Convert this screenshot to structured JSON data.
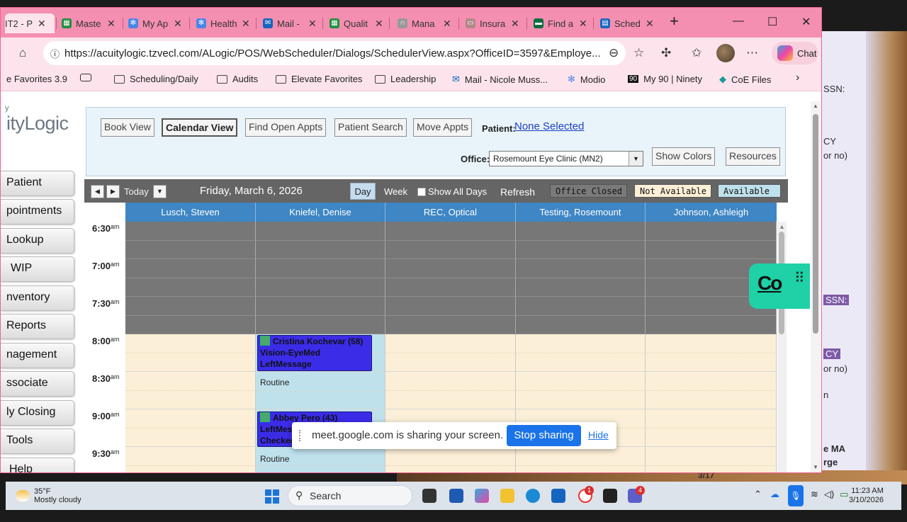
{
  "browser": {
    "tabs": [
      {
        "label": "IT2 - P",
        "icon_color": "#e91e63"
      },
      {
        "label": "Maste",
        "icon_color": "#1e8e3e"
      },
      {
        "label": "My Ap",
        "icon_color": "#4a86e8"
      },
      {
        "label": "Health",
        "icon_color": "#4a86e8"
      },
      {
        "label": "Mail -",
        "icon_color": "#1565c0"
      },
      {
        "label": "Qualit",
        "icon_color": "#1e8e3e"
      },
      {
        "label": "Mana",
        "icon_color": "#888888"
      },
      {
        "label": "Insura",
        "icon_color": "#888888"
      },
      {
        "label": "Find a",
        "icon_color": "#0b6e3d"
      },
      {
        "label": "Sched",
        "icon_color": "#1565c0"
      }
    ],
    "url": "https://acuitylogic.tzvecl.com/ALogic/POS/WebScheduler/Dialogs/SchedulerView.aspx?OfficeID=3597&Employe...",
    "chat_label": "Chat",
    "favorites": [
      "e Favorites 3.9",
      "Scheduling/Daily",
      "Audits",
      "Elevate Favorites",
      "Leadership",
      "Mail - Nicole Muss...",
      "Modio",
      "My 90 | Ninety",
      "CoE Files"
    ]
  },
  "app": {
    "logo_text": "ityLogic",
    "logo_small": "y",
    "nav_buttons": [
      "Patient",
      "pointments",
      "Lookup",
      "WIP",
      "nventory",
      "Reports",
      "nagement",
      "ssociate",
      "ly Closing",
      "Tools",
      "Help"
    ],
    "toolbar": {
      "book_view": "Book View",
      "calendar_view": "Calendar View",
      "find_open_appts": "Find Open Appts",
      "patient_search": "Patient Search",
      "move_appts": "Move Appts",
      "patient_label": "Patient:",
      "patient_value": "None Selected",
      "office_label": "Office:",
      "office_value": "Rosemount Eye Clinic (MN2)",
      "show_colors": "Show Colors",
      "resources": "Resources"
    },
    "calendar": {
      "today_label": "Today",
      "date": "Friday, March 6, 2026",
      "day_label": "Day",
      "week_label": "Week",
      "show_all_days": "Show All Days",
      "refresh": "Refresh",
      "legend": {
        "office_closed": "Office Closed",
        "not_available": "Not Available",
        "available": "Available",
        "office_closed_color": "#7a7a7a",
        "not_available_color": "#fcefd7",
        "available_color": "#bfe1ec"
      },
      "columns": [
        "Lusch, Steven",
        "Kniefel, Denise",
        "REC, Optical",
        "Testing, Rosemount",
        "Johnson, Ashleigh"
      ],
      "times": [
        {
          "t": "6:30",
          "ap": "am"
        },
        {
          "t": "7:00",
          "ap": "am"
        },
        {
          "t": "7:30",
          "ap": "am"
        },
        {
          "t": "8:00",
          "ap": "am"
        },
        {
          "t": "8:30",
          "ap": "am"
        },
        {
          "t": "9:00",
          "ap": "am"
        },
        {
          "t": "9:30",
          "ap": "am"
        }
      ],
      "appointments": [
        {
          "name": "Cristina Kochevar (58)",
          "line2": "Vision-EyeMed",
          "line3": "LeftMessage"
        },
        {
          "name": "Abbey Pero (43)",
          "line2": "LeftMess",
          "line3": "Checked"
        }
      ],
      "routine_label": "Routine"
    }
  },
  "screenshare": {
    "message": "meet.google.com is sharing your screen.",
    "stop": "Stop sharing",
    "hide": "Hide"
  },
  "background_window": {
    "lines": [
      "SSN:",
      "CY",
      "or no)",
      "SSN:",
      "CY",
      "or no)",
      "n",
      "e MA",
      "rge"
    ],
    "date": "3/17"
  },
  "taskbar": {
    "temp": "35°F",
    "weather": "Mostly cloudy",
    "search": "Search",
    "time": "11:23 AM",
    "date": "3/10/2026",
    "badge1": "1",
    "badge2": "4"
  }
}
